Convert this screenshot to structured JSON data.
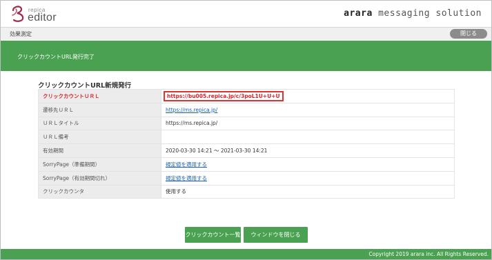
{
  "header": {
    "logo_small": "repica",
    "logo_big": "editor",
    "brand_prefix": "arara",
    "brand_suffix": " messaging solution"
  },
  "subbar": {
    "breadcrumb": "効果測定",
    "close_label": "閉じる"
  },
  "banner": {
    "title": "クリックカウントURL発行完了"
  },
  "section": {
    "title": "クリックカウントURL新規発行"
  },
  "rows": [
    {
      "label": "クリックカウントＵＲＬ",
      "value": "https://bu005.repica.jp/c/3poL1U+U+U"
    },
    {
      "label": "遷移先ＵＲＬ",
      "value": "https://ms.repica.jp/"
    },
    {
      "label": "ＵＲＬタイトル",
      "value": "https://ms.repica.jp/"
    },
    {
      "label": "ＵＲＬ備考",
      "value": ""
    },
    {
      "label": "有効期間",
      "value": "2020-03-30 14:21 ～ 2021-03-30 14:21"
    },
    {
      "label": "SorryPage（準備期間）",
      "value": "規定値を適用する"
    },
    {
      "label": "SorryPage（有効期間切れ）",
      "value": "規定値を適用する"
    },
    {
      "label": "クリックカウンタ",
      "value": "使用する"
    }
  ],
  "buttons": {
    "list_label": "クリックカウント一覧",
    "close_window_label": "ウィンドウを閉じる"
  },
  "footer": {
    "copyright": "Copyright 2019 arara inc. All Rights Reserved."
  },
  "colors": {
    "accent_green": "#4aa152",
    "highlight_red": "#e0312f",
    "link_blue": "#1a5fb4"
  }
}
